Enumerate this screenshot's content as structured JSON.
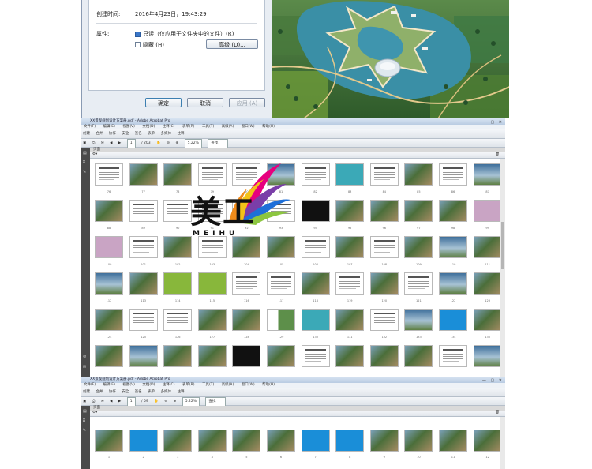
{
  "dialog": {
    "created_label": "创建时间:",
    "created_value": "2016年4月23日，19:43:29",
    "attributes_label": "属性:",
    "readonly_label": "只读（仅应用于文件夹中的文件）(R)",
    "hidden_label": "隐藏 (H)",
    "advanced_button": "高级 (D)...",
    "ok_button": "确定",
    "cancel_button": "取消",
    "apply_button": "应用 (A)"
  },
  "acrobat_top": {
    "title": "XX景观规划设计方案册.pdf - Adobe Acrobat Pro",
    "menus": [
      "文件(F)",
      "编辑(E)",
      "视图(V)",
      "文档(D)",
      "注释(C)",
      "表单(R)",
      "工具(T)",
      "高级(A)",
      "窗口(W)",
      "帮助(H)"
    ],
    "toolbar": [
      "创建",
      "合并",
      "协作",
      "安全",
      "签名",
      "表单",
      "多媒体",
      "注释"
    ],
    "page_current": "1",
    "page_total": "/ 203",
    "zoom": "5.22%",
    "find_placeholder": "查找",
    "pane_title": "页面",
    "row_numbers": [
      [
        "",
        "",
        "",
        "",
        "",
        "",
        "",
        "",
        "",
        "",
        "",
        ""
      ],
      [
        "76",
        "77",
        "78",
        "79",
        "80",
        "81",
        "82",
        "83",
        "84",
        "85",
        "86",
        "87"
      ],
      [
        "88",
        "89",
        "90",
        "91",
        "92",
        "93",
        "94",
        "95",
        "96",
        "97",
        "98",
        "99"
      ],
      [
        "100",
        "101",
        "102",
        "103",
        "104",
        "105",
        "106",
        "107",
        "108",
        "109",
        "110",
        "111"
      ],
      [
        "112",
        "113",
        "114",
        "115",
        "116",
        "117",
        "118",
        "119",
        "120",
        "121",
        "122",
        "123"
      ],
      [
        "124",
        "125",
        "126",
        "127",
        "128",
        "129",
        "130",
        "131",
        "132",
        "133",
        "134",
        "135"
      ]
    ]
  },
  "acrobat_bottom": {
    "title": "XX景观规划设计方案册.pdf - Adobe Acrobat Pro",
    "menus": [
      "文件(F)",
      "编辑(E)",
      "视图(V)",
      "文档(D)",
      "注释(C)",
      "表单(R)",
      "工具(T)",
      "高级(A)",
      "窗口(W)",
      "帮助(H)"
    ],
    "toolbar": [
      "创建",
      "合并",
      "协作",
      "安全",
      "签名",
      "表单",
      "多媒体",
      "注释"
    ],
    "page_current": "1",
    "page_total": "/ 59",
    "zoom": "5.22%",
    "find_placeholder": "查找",
    "pane_title": "页面",
    "row_numbers": [
      "1",
      "2",
      "3",
      "4",
      "5",
      "6",
      "7",
      "8",
      "9",
      "10",
      "11",
      "12"
    ]
  },
  "logo": {
    "text": "美工",
    "subtext": "MEIHU",
    "colors": [
      "#e6007e",
      "#7a3ea8",
      "#1e6fd8",
      "#f3c218",
      "#8cc63f",
      "#f28c1b"
    ]
  },
  "accent_colors": {
    "dialog_bg": "#e8edf3",
    "acrobat_frame": "#3a3a3a",
    "teal_page": "#2aa6b8",
    "blue_page": "#1a8ed8",
    "pink_page": "#d7a3cc",
    "green_page": "#86b83a"
  }
}
